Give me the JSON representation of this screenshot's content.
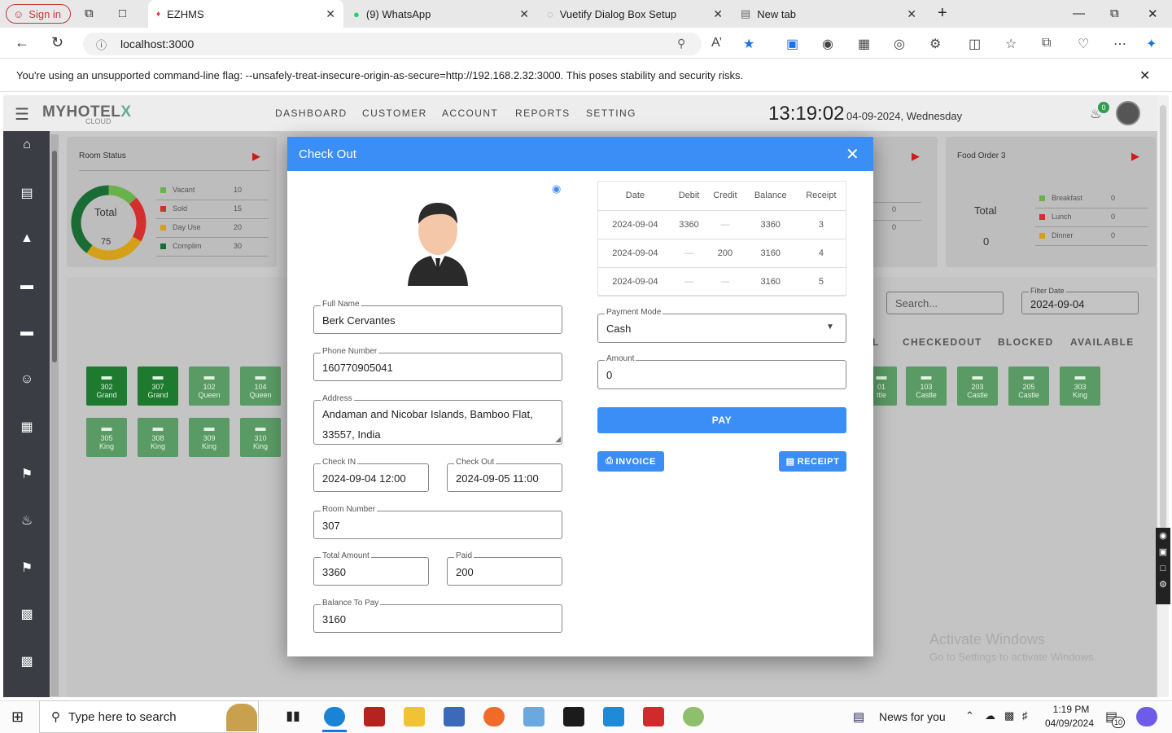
{
  "browser": {
    "signin_label": "Sign in",
    "tabs": [
      {
        "title": "EZHMS"
      },
      {
        "title": "(9) WhatsApp"
      },
      {
        "title": "Vuetify Dialog Box Setup"
      },
      {
        "title": "New tab"
      }
    ],
    "url": "localhost:3000",
    "infobar_text": "You're using an unsupported command-line flag: --unsafely-treat-insecure-origin-as-secure=http://192.168.2.32:3000. This poses stability and security risks."
  },
  "app": {
    "logo": "MYHOTEL",
    "logo_sub": "CLOUD",
    "nav": [
      "DASHBOARD",
      "CUSTOMER",
      "ACCOUNT",
      "REPORTS",
      "SETTING"
    ],
    "clock": "13:19:02",
    "date": "04-09-2024, Wednesday",
    "notif_count": "0",
    "room_status": {
      "title": "Room Status",
      "total_label": "Total",
      "total_value": "75",
      "legend": [
        {
          "label": "Vacant",
          "value": "10",
          "color": "#6ab04c"
        },
        {
          "label": "Sold",
          "value": "15",
          "color": "#d32f2f"
        },
        {
          "label": "Day Use",
          "value": "20",
          "color": "#d4a017"
        },
        {
          "label": "Complim",
          "value": "30",
          "color": "#1b6b35"
        }
      ]
    },
    "food_order": {
      "title": "Food Order 3",
      "total_label": "Total",
      "total_value": "0",
      "legend": [
        {
          "label": "Breakfast",
          "value": "0",
          "color": "#6ab04c"
        },
        {
          "label": "Lunch",
          "value": "0",
          "color": "#d32f2f"
        },
        {
          "label": "Dinner",
          "value": "0",
          "color": "#d4a017"
        }
      ]
    },
    "middle_card_values": [
      "0",
      "0"
    ],
    "search_placeholder": "Search...",
    "filter_date_label": "Filter Date",
    "filter_date_value": "2024-09-04",
    "status_tabs": [
      "L",
      "CHECKEDOUT",
      "BLOCKED",
      "AVAILABLE"
    ],
    "rooms_left": [
      {
        "num": "302",
        "type": "Grand"
      },
      {
        "num": "307",
        "type": "Grand"
      },
      {
        "num": "102",
        "type": "Queen"
      },
      {
        "num": "104",
        "type": "Queen"
      },
      {
        "num": "305",
        "type": "King"
      },
      {
        "num": "308",
        "type": "King"
      },
      {
        "num": "309",
        "type": "King"
      },
      {
        "num": "310",
        "type": "King"
      }
    ],
    "rooms_right": [
      {
        "num": "01",
        "type": "ttle"
      },
      {
        "num": "103",
        "type": "Castle"
      },
      {
        "num": "203",
        "type": "Castle"
      },
      {
        "num": "205",
        "type": "Castle"
      },
      {
        "num": "303",
        "type": "King"
      }
    ],
    "watermark_line1": "Activate Windows",
    "watermark_line2": "Go to Settings to activate Windows."
  },
  "dialog": {
    "title": "Check Out",
    "full_name_label": "Full Name",
    "full_name": "Berk Cervantes",
    "phone_label": "Phone Number",
    "phone": "160770905041",
    "address_label": "Address",
    "address_line1": "Andaman and Nicobar Islands, Bamboo Flat,",
    "address_line2": "33557, India",
    "check_in_label": "Check IN",
    "check_in": "2024-09-04 12:00",
    "check_out_label": "Check Out",
    "check_out": "2024-09-05 11:00",
    "room_number_label": "Room Number",
    "room_number": "307",
    "total_amount_label": "Total Amount",
    "total_amount": "3360",
    "paid_label": "Paid",
    "paid": "200",
    "balance_label": "Balance To Pay",
    "balance": "3160",
    "table": {
      "headers": [
        "Date",
        "Debit",
        "Credit",
        "Balance",
        "Receipt"
      ],
      "rows": [
        [
          "2024-09-04",
          "3360",
          "—",
          "3360",
          "3"
        ],
        [
          "2024-09-04",
          "—",
          "200",
          "3160",
          "4"
        ],
        [
          "2024-09-04",
          "—",
          "—",
          "3160",
          "5"
        ]
      ]
    },
    "payment_mode_label": "Payment Mode",
    "payment_mode": "Cash",
    "amount_label": "Amount",
    "amount": "0",
    "pay_label": "PAY",
    "invoice_label": "INVOICE",
    "receipt_label": "RECEIPT"
  },
  "taskbar": {
    "search_placeholder": "Type here to search",
    "news": "News for you",
    "time": "1:19 PM",
    "date": "04/09/2024",
    "notif_count": "10"
  }
}
